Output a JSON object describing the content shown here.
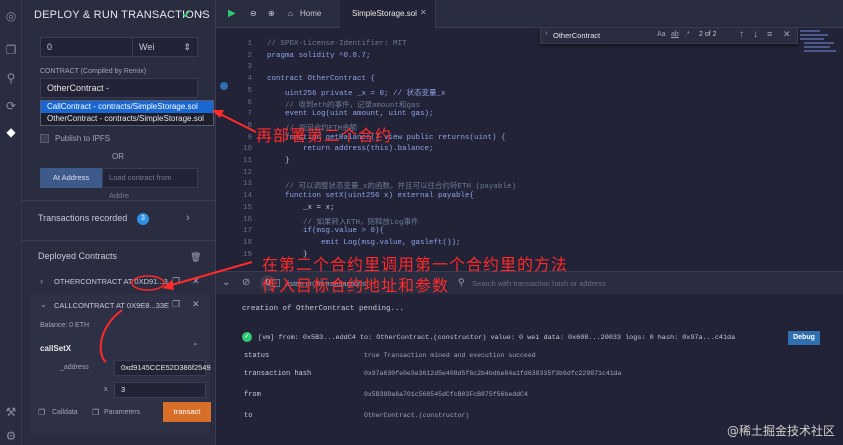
{
  "panel": {
    "title": "DEPLOY & RUN TRANSACTIONS",
    "value": "0",
    "unit": "Wei",
    "contract_label": "CONTRACT (Compiled by Remix)",
    "contract_selected": "OtherContract - contracts/SimpleStor:",
    "dropdown_options": [
      "CallContract - contracts/SimpleStorage.sol",
      "OtherContract - contracts/SimpleStorage.sol"
    ],
    "publish": "Publish to IPFS",
    "or": "OR",
    "at_address": "At Address",
    "load_contract": "Load contract from Addre",
    "tx_recorded": "Transactions recorded",
    "tx_count": "3",
    "deployed": "Deployed Contracts",
    "other_contract": "OTHERCONTRACT AT 0XD91...3",
    "call_contract": "CALLCONTRACT AT 0X9E8...33E",
    "balance": "Balance: 0 ETH",
    "func_name": "callSetX",
    "addr_label": "_address",
    "addr_value": "0xd9145CCE52D386f2549",
    "x_label": "x",
    "x_value": "3",
    "calldata": "Calldata",
    "parameters": "Parameters",
    "transact": "transact"
  },
  "tabs": {
    "home": "Home",
    "file": "SimpleStorage.sol"
  },
  "find": {
    "query": "OtherContract",
    "aa": "Aa",
    "ab": "ab",
    "star": ".*",
    "count": "2 of 2"
  },
  "code": {
    "lines": [
      {
        "n": "1",
        "t": "// SPDX-License-Identifier: MIT",
        "c": "#6b7a95"
      },
      {
        "n": "2",
        "t": "pragma solidity ^0.8.7;",
        "c": "#8fa3e8"
      },
      {
        "n": "3",
        "t": "",
        "c": "#c8c9d8"
      },
      {
        "n": "4",
        "t": "contract OtherContract {",
        "c": "#8fa3e8"
      },
      {
        "n": "5",
        "t": "    uint256 private _x = 0; // 状态变量_x",
        "c": "#8fa3e8"
      },
      {
        "n": "6",
        "t": "    // 收到eth的事件，记录amount和gas",
        "c": "#6b7a95"
      },
      {
        "n": "7",
        "t": "    event Log(uint amount, uint gas);",
        "c": "#8fa3e8"
      },
      {
        "n": "8",
        "t": "    // 返回合约ETH余额",
        "c": "#6b7a95"
      },
      {
        "n": "9",
        "t": "    function getBalance() view public returns(uint) {",
        "c": "#8fa3e8"
      },
      {
        "n": "10",
        "t": "        return address(this).balance;",
        "c": "#8fa3e8"
      },
      {
        "n": "11",
        "t": "    }",
        "c": "#c8c9d8"
      },
      {
        "n": "12",
        "t": "",
        "c": "#c8c9d8"
      },
      {
        "n": "13",
        "t": "    // 可以调整状态变量_x的函数，并且可以往合约转ETH (payable)",
        "c": "#6b7a95"
      },
      {
        "n": "14",
        "t": "    function setX(uint256 x) external payable{",
        "c": "#8fa3e8"
      },
      {
        "n": "15",
        "t": "        _x = x;",
        "c": "#c8c9d8"
      },
      {
        "n": "16",
        "t": "        // 如果转入ETH，则释放Log事件",
        "c": "#6b7a95"
      },
      {
        "n": "17",
        "t": "        if(msg.value > 0){",
        "c": "#8fa3e8"
      },
      {
        "n": "18",
        "t": "            emit Log(msg.value, gasleft());",
        "c": "#8fa3e8"
      },
      {
        "n": "19",
        "t": "        }",
        "c": "#c8c9d8"
      }
    ]
  },
  "terminal": {
    "listen": "listen on all transactions",
    "search": "Search with transaction hash or address",
    "pending": "creation of OtherContract pending...",
    "log": "[vm] from: 0x5B3...eddC4 to: OtherContract.(constructor) value: 0 wei data: 0x608...20033 logs: 0 hash: 0x97a...c41da",
    "debug": "Debug",
    "rows": [
      {
        "k": "status",
        "v": "true Transaction mined and execution succeed"
      },
      {
        "k": "transaction hash",
        "v": "0x97a630fe0e3e3612d5e408d5f6c2b4bdbe84a1fd638335f3b9dfc229871c41da"
      },
      {
        "k": "from",
        "v": "0x5B38Da6a701c568545dCfcB03FcB875f56beddC4"
      },
      {
        "k": "to",
        "v": "OtherContract.(constructor)"
      }
    ]
  },
  "annotations": {
    "a1": "再部署第二个合约",
    "a2": "在第二个合约里调用第一个合约里的方法",
    "a3": "传入目标合约地址和参数"
  },
  "watermark": "@稀土掘金技术社区"
}
